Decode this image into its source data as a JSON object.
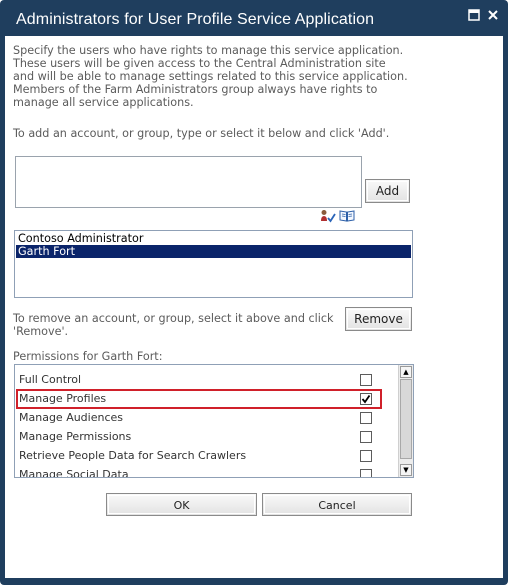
{
  "dialog": {
    "title": "Administrators for User Profile Service Application",
    "maximize_icon": "maximize-icon",
    "close_icon": "close-icon"
  },
  "instructions": {
    "line1": "Specify the users who have rights to manage this service application.",
    "line2": "These users will be given access to the Central Administration site",
    "line3": "and will be able to manage settings related to this service application.",
    "line4": "Members of the Farm Administrators group always have rights to",
    "line5": "manage all service applications.",
    "add_hint": "To add an account, or group, type or select it below and click 'Add'."
  },
  "people_picker": {
    "value": "",
    "add_label": "Add",
    "check_names_icon": "check-names-icon",
    "browse_icon": "address-book-icon"
  },
  "users": [
    {
      "name": "Contoso Administrator",
      "selected": false
    },
    {
      "name": "Garth Fort",
      "selected": true
    }
  ],
  "remove": {
    "hint_line1": "To remove an account, or group, select it above and click",
    "hint_line2": "'Remove'.",
    "remove_label": "Remove"
  },
  "permissions": {
    "heading": "Permissions for Garth Fort:",
    "items": [
      {
        "label": "Full Control",
        "checked": false
      },
      {
        "label": "Manage Profiles",
        "checked": true
      },
      {
        "label": "Manage Audiences",
        "checked": false
      },
      {
        "label": "Manage Permissions",
        "checked": false
      },
      {
        "label": "Retrieve People Data for Search Crawlers",
        "checked": false
      },
      {
        "label": "Manage Social Data",
        "checked": false
      }
    ]
  },
  "footer": {
    "ok_label": "OK",
    "cancel_label": "Cancel"
  },
  "colors": {
    "title_bar": "#1f3e5e",
    "selection": "#0a246a",
    "highlight_border": "#d0202a"
  }
}
